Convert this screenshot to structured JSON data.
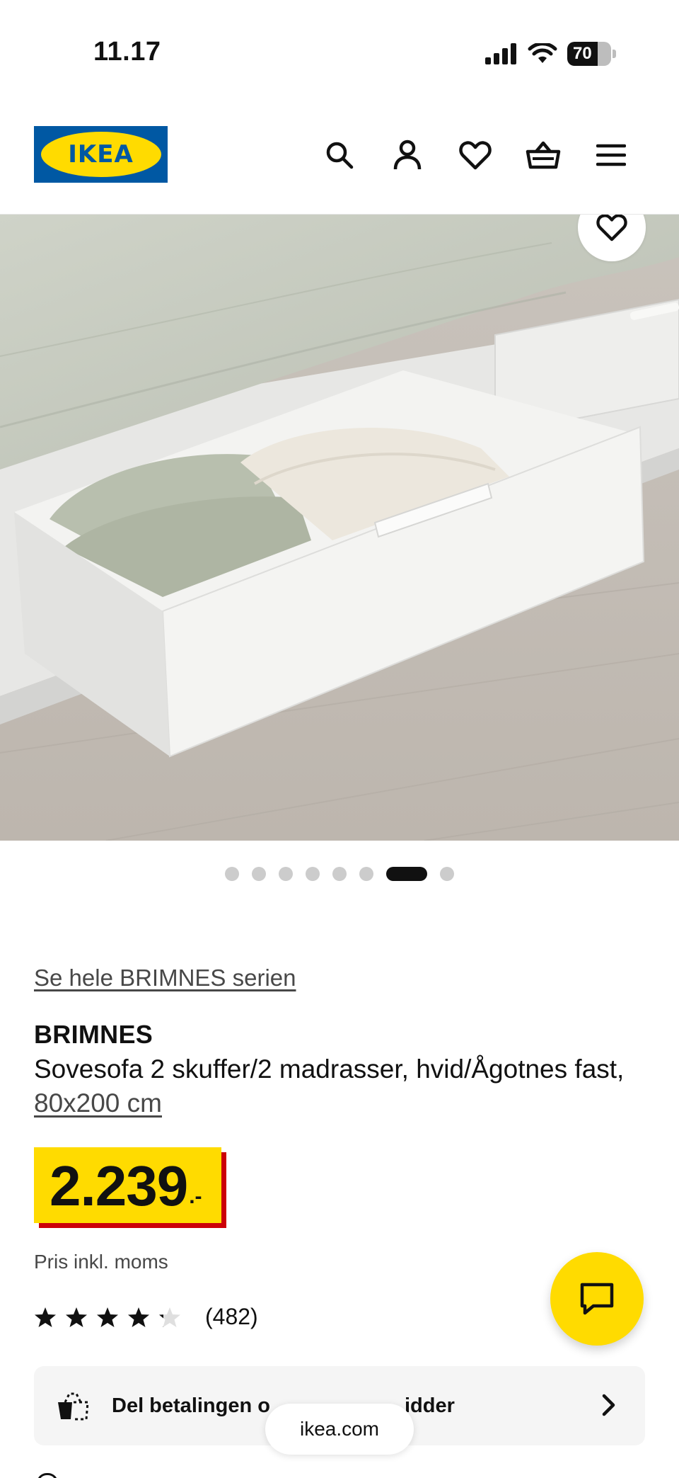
{
  "status_bar": {
    "time": "11.17",
    "battery_level": "70",
    "icons": [
      "signal-icon",
      "wifi-icon",
      "battery-icon"
    ]
  },
  "header": {
    "logo_text": "IKEA",
    "brand_colors": {
      "blue": "#0058a3",
      "yellow": "#ffdb00"
    },
    "icons": [
      "search-icon",
      "account-icon",
      "favourites-icon",
      "basket-icon",
      "menu-icon"
    ]
  },
  "gallery": {
    "image_alt": "",
    "image_count": 8,
    "active_index": 6,
    "favourite_icon": "heart-icon"
  },
  "product": {
    "series_link": "Se hele BRIMNES serien",
    "name": "BRIMNES",
    "description": "Sovesofa 2 skuffer/2 madrasser, hvid/Ågotnes fast, ",
    "size": "80x200 cm",
    "price": "2.239",
    "price_suffix": ".-",
    "price_colors": {
      "background": "#ffdb00",
      "accent": "#cc0008"
    },
    "vat_note": "Pris inkl. moms",
    "rating": 4.2,
    "rating_max": 5,
    "review_count": "(482)"
  },
  "payment": {
    "label": "Del betalingen op i ...",
    "visible_start": "Del betalingen o",
    "visible_end": "idder"
  },
  "browser": {
    "url": "ikea.com"
  }
}
